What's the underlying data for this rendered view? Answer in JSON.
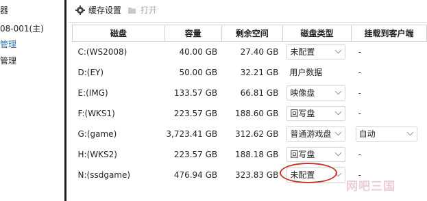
{
  "sidebar": {
    "items": [
      {
        "label": "器"
      },
      {
        "label": "08-001(主)"
      },
      {
        "label": "管理"
      },
      {
        "label": "管理"
      }
    ]
  },
  "toolbar": {
    "cache_settings_label": "缓存设置",
    "open_label": "打开"
  },
  "table": {
    "headers": [
      "磁盘",
      "容量",
      "剩余空间",
      "磁盘类型",
      "挂载到客户端"
    ],
    "rows": [
      {
        "disk": "C:(WS2008)",
        "capacity": "40.00 GB",
        "free": "27.40 GB",
        "type": "未配置",
        "mount": "-"
      },
      {
        "disk": "D:(EY)",
        "capacity": "50.00 GB",
        "free": "32.21 GB",
        "type": "用户数据",
        "mount": "-"
      },
      {
        "disk": "E:(IMG)",
        "capacity": "133.57 GB",
        "free": "66.81 GB",
        "type": "映像盘",
        "mount": "-"
      },
      {
        "disk": "F:(WKS1)",
        "capacity": "223.57 GB",
        "free": "188.60 GB",
        "type": "回写盘",
        "mount": "-"
      },
      {
        "disk": "G:(game)",
        "capacity": "3,723.41 GB",
        "free": "312.62 GB",
        "type": "普通游戏盘",
        "mount": "自动"
      },
      {
        "disk": "H:(WKS2)",
        "capacity": "223.57 GB",
        "free": "188.18 GB",
        "type": "回写盘",
        "mount": "-"
      },
      {
        "disk": "N:(ssdgame)",
        "capacity": "476.94 GB",
        "free": "323.83 GB",
        "type": "未配置",
        "mount": "-"
      }
    ]
  },
  "watermark": "网吧三国",
  "colors": {
    "highlight": "#c0392b",
    "border": "#d0d0d0"
  }
}
